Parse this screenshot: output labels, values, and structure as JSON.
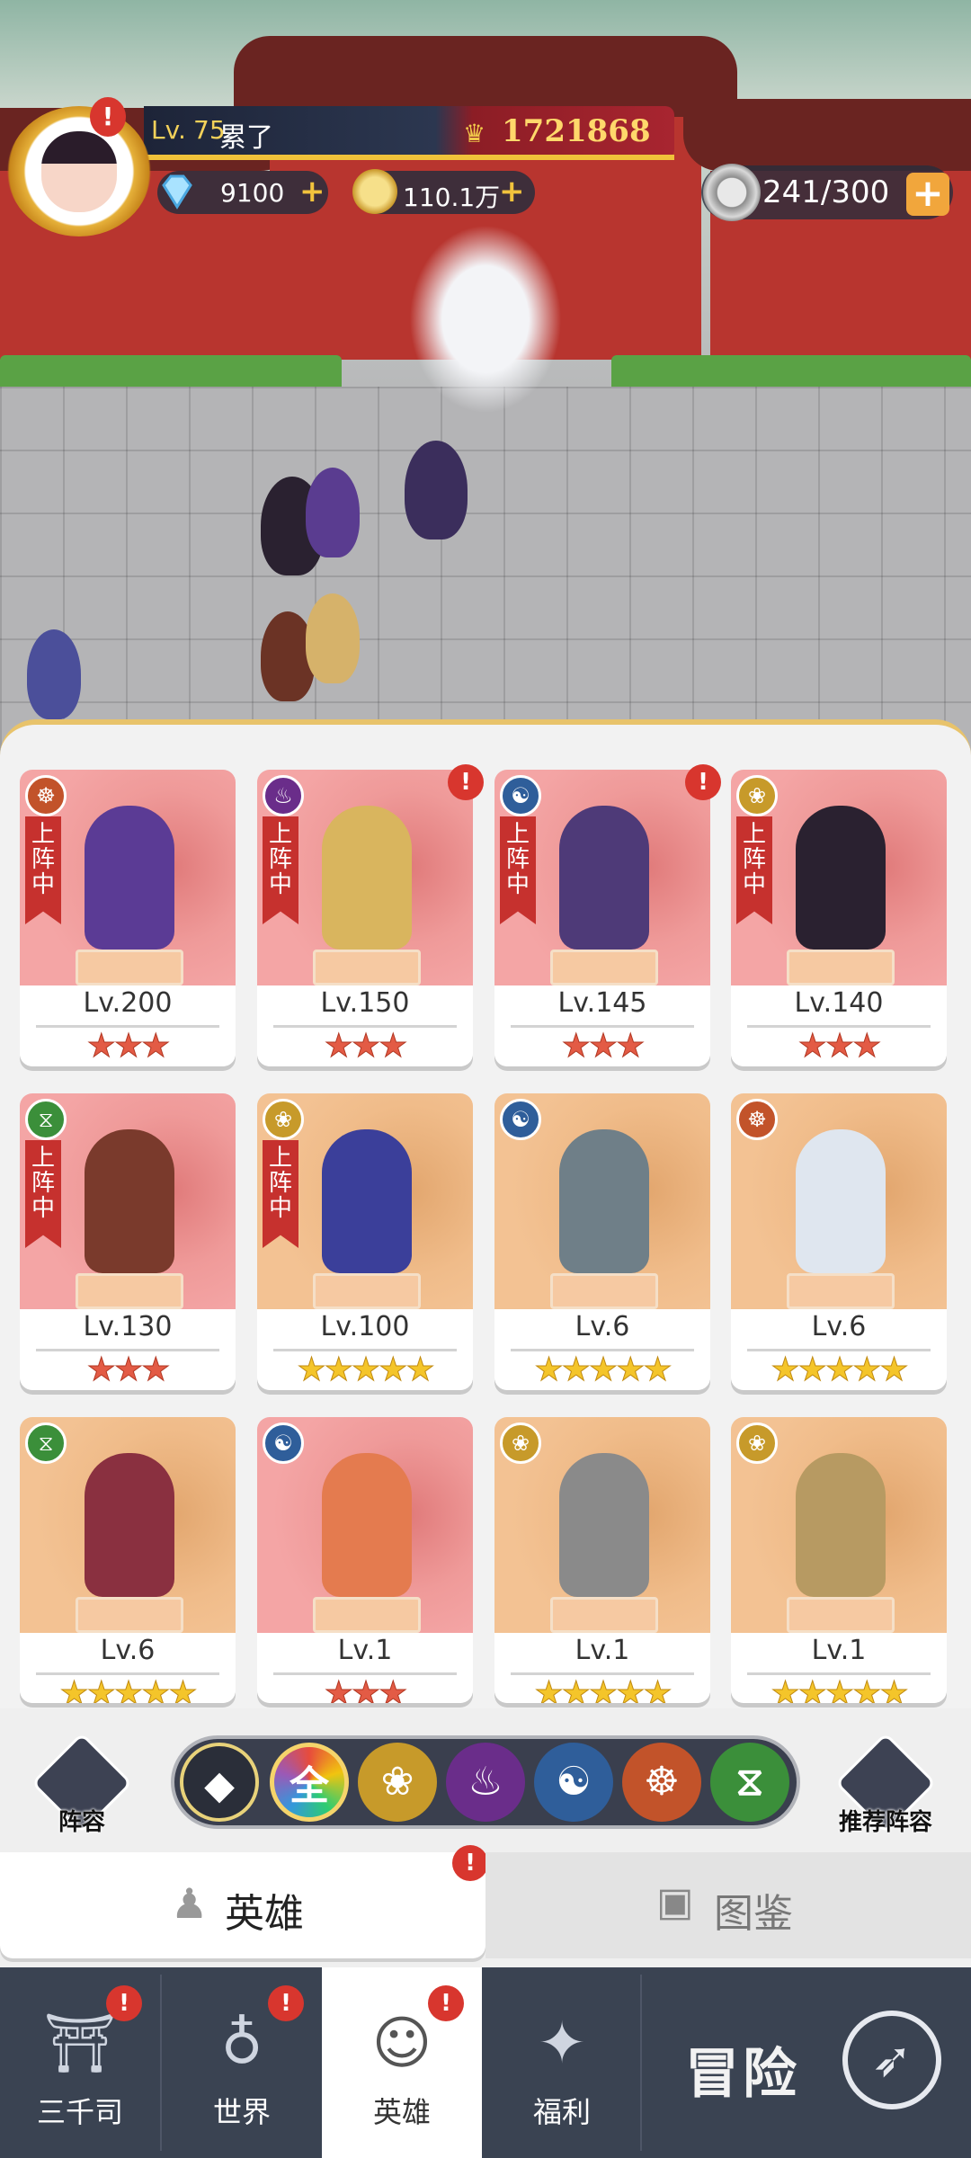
{
  "hud": {
    "level_prefix": "Lv.",
    "level": "75",
    "player_name": "累了",
    "power": "1721868",
    "gems": "9100",
    "gold": "110.1万",
    "stamina": "241/300",
    "plus": "+"
  },
  "heroes": [
    {
      "level": "Lv.200",
      "stars": "★★★",
      "star_color": "red",
      "card_color": "pink",
      "element": "ascetic-icon",
      "deployed": true,
      "alert": false
    },
    {
      "level": "Lv.150",
      "stars": "★★★",
      "star_color": "red",
      "card_color": "pink",
      "element": "flame-icon",
      "deployed": true,
      "alert": true
    },
    {
      "level": "Lv.145",
      "stars": "★★★",
      "star_color": "red",
      "card_color": "pink",
      "element": "taiji-icon",
      "deployed": true,
      "alert": true
    },
    {
      "level": "Lv.140",
      "stars": "★★★",
      "star_color": "red",
      "card_color": "pink",
      "element": "lotus-icon",
      "deployed": true,
      "alert": false
    },
    {
      "level": "Lv.130",
      "stars": "★★★",
      "star_color": "red",
      "card_color": "pink",
      "element": "dna-icon",
      "deployed": true,
      "alert": false
    },
    {
      "level": "Lv.100",
      "stars": "★★★★★",
      "star_color": "gold",
      "card_color": "orange",
      "element": "lotus-icon",
      "deployed": true,
      "alert": false
    },
    {
      "level": "Lv.6",
      "stars": "★★★★★",
      "star_color": "gold",
      "card_color": "orange",
      "element": "taiji-icon",
      "deployed": false,
      "alert": false
    },
    {
      "level": "Lv.6",
      "stars": "★★★★★",
      "star_color": "gold",
      "card_color": "orange",
      "element": "ascetic-icon",
      "deployed": false,
      "alert": false
    },
    {
      "level": "Lv.6",
      "stars": "★★★★★",
      "star_color": "gold",
      "card_color": "orange",
      "element": "dna-icon",
      "deployed": false,
      "alert": false
    },
    {
      "level": "Lv.1",
      "stars": "★★★",
      "star_color": "red",
      "card_color": "pink",
      "element": "taiji-icon",
      "deployed": false,
      "alert": false
    },
    {
      "level": "Lv.1",
      "stars": "★★★★★",
      "star_color": "gold",
      "card_color": "orange",
      "element": "lotus-icon",
      "deployed": false,
      "alert": false
    },
    {
      "level": "Lv.1",
      "stars": "★★★★★",
      "star_color": "gold",
      "card_color": "orange",
      "element": "lotus-icon",
      "deployed": false,
      "alert": false
    }
  ],
  "deploy_badge": "上阵中",
  "lineup_label": "阵容",
  "recommend_label": "推荐阵容",
  "filter_all": "全",
  "tabs": {
    "heroes": "英雄",
    "codex": "图鉴"
  },
  "nav": {
    "sanqiansi": "三千司",
    "world": "世界",
    "heroes": "英雄",
    "welfare": "福利",
    "adventure": "冒险"
  },
  "colors": {
    "element_ascetic": "#c2532a",
    "element_flame": "#6a2d8a",
    "element_taiji": "#2f5e9a",
    "element_lotus": "#c79a2a",
    "element_dna": "#3b8f3a",
    "alert_red": "#d8362e"
  }
}
